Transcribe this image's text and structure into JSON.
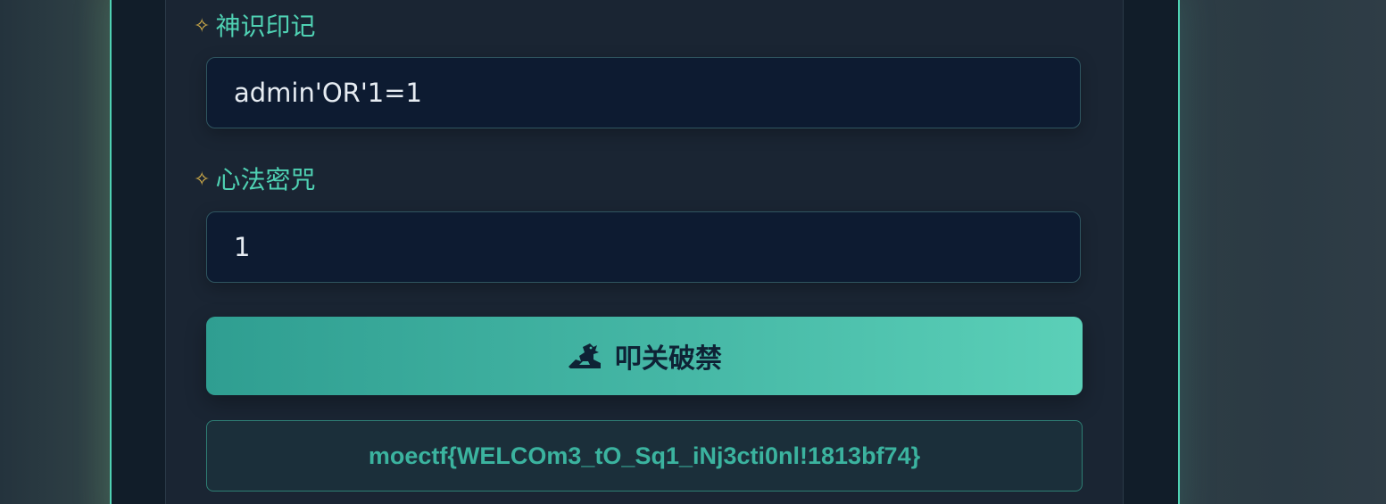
{
  "form": {
    "username_label": "神识印记",
    "username_value": "admin'OR'1=1",
    "password_label": "心法密咒",
    "password_value": "1",
    "label_icon": "sparkle-icon",
    "submit_icon": "dragon-icon",
    "submit_label": "叩关破禁"
  },
  "result": {
    "flag_text": "moectf{WELCOm3_tO_Sq1_iNj3cti0nl!1813bf74}"
  },
  "colors": {
    "accent": "#4fd1b3",
    "label_star": "#d8b24a",
    "button_start": "#2f9e91",
    "button_end": "#5bd0b8",
    "input_bg": "#0d1b31",
    "flag_text": "#3bb39f"
  }
}
